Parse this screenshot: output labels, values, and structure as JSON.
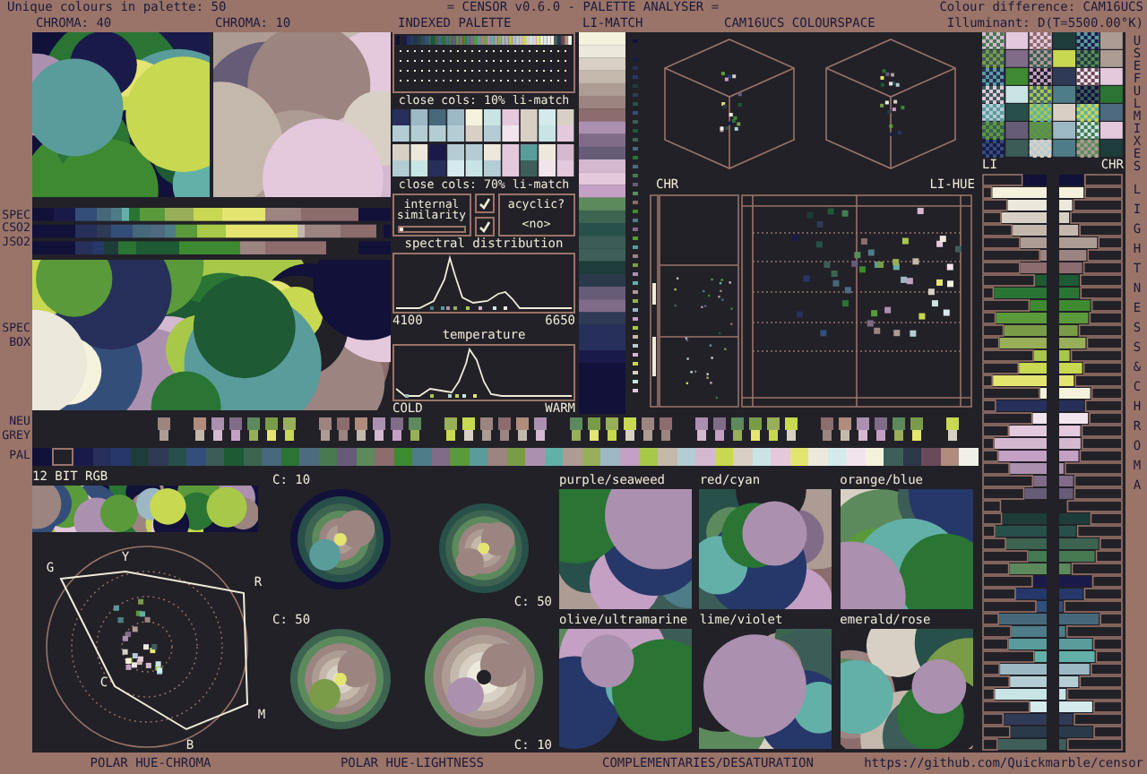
{
  "header": {
    "palette_count": "Unique colours in palette: 50",
    "title": "= CENSOR v0.6.0 - PALETTE ANALYSER =",
    "colour_difference": "Colour difference: CAM16UCS",
    "illuminant": "Illuminant: D(T=5500.00°K)"
  },
  "chroma_maps": [
    {
      "label": "CHROMA: 40"
    },
    {
      "label": "CHROMA: 10"
    }
  ],
  "spectrum_rows": [
    {
      "label": "SPEC"
    },
    {
      "label": "CSO2"
    },
    {
      "label": "JSO2"
    }
  ],
  "spec_box": {
    "label": "SPEC BOX"
  },
  "indexed_palette": {
    "title": "INDEXED PALETTE",
    "close_10": "close cols: 10% li-match",
    "close_70": "close cols: 70% li-match",
    "internal_similarity": {
      "label": "internal similarity",
      "checked": true,
      "level": 0.05
    },
    "acyclic": {
      "label": "acyclic?",
      "checked": true,
      "value": "<no>"
    },
    "spectral": {
      "title": "spectral distribution",
      "min": "4100",
      "max": "6650"
    },
    "temperature": {
      "title": "temperature",
      "min": "COLD",
      "max": "WARM"
    }
  },
  "li_match": {
    "title": "LI-MATCH"
  },
  "colourspace": {
    "title": "CAM16UCS COLOURSPACE",
    "chroma_label": "CHR",
    "hue_label": "LI-HUE"
  },
  "neutral_grey": {
    "label": "NEU GREY"
  },
  "pal": {
    "label": "PAL",
    "swatches": [
      {
        "color": "#11113a",
        "selected": false
      },
      {
        "color": "#222128",
        "selected": true
      },
      {
        "color": "#1a1a4a",
        "selected": false
      },
      {
        "color": "#26305a",
        "selected": false
      },
      {
        "color": "#26386a",
        "selected": false
      },
      {
        "color": "#1e3c3a",
        "selected": false
      },
      {
        "color": "#2f3a56",
        "selected": false
      },
      {
        "color": "#28504a",
        "selected": false
      },
      {
        "color": "#344e7a",
        "selected": false
      },
      {
        "color": "#3c5c58",
        "selected": false
      },
      {
        "color": "#1e5a34",
        "selected": false
      },
      {
        "color": "#3c6450",
        "selected": false
      },
      {
        "color": "#46687a",
        "selected": false
      },
      {
        "color": "#2a7434",
        "selected": false
      },
      {
        "color": "#4e6a80",
        "selected": false
      },
      {
        "color": "#467a50",
        "selected": false
      },
      {
        "color": "#665c78",
        "selected": false
      },
      {
        "color": "#5c8a5c",
        "selected": false
      },
      {
        "color": "#8c6c6c",
        "selected": false
      },
      {
        "color": "#3e8a30",
        "selected": false
      },
      {
        "color": "#4e7c88",
        "selected": false
      },
      {
        "color": "#806c88",
        "selected": false
      },
      {
        "color": "#5a9a3a",
        "selected": false
      },
      {
        "color": "#5a9c9c",
        "selected": false
      },
      {
        "color": "#9c8480",
        "selected": false
      },
      {
        "color": "#7a9c48",
        "selected": false
      },
      {
        "color": "#ac90b0",
        "selected": false
      },
      {
        "color": "#62b0a8",
        "selected": false
      },
      {
        "color": "#ac9c94",
        "selected": false
      },
      {
        "color": "#98ae58",
        "selected": false
      },
      {
        "color": "#9cb8c4",
        "selected": false
      },
      {
        "color": "#c4a0c4",
        "selected": false
      },
      {
        "color": "#a8c84a",
        "selected": false
      },
      {
        "color": "#c4b8ac",
        "selected": false
      },
      {
        "color": "#b4ccd4",
        "selected": false
      },
      {
        "color": "#d4b8d0",
        "selected": false
      },
      {
        "color": "#c8d850",
        "selected": false
      },
      {
        "color": "#d8d0c4",
        "selected": false
      },
      {
        "color": "#c8e4e4",
        "selected": false
      },
      {
        "color": "#e4c8dc",
        "selected": false
      },
      {
        "color": "#e4e470",
        "selected": false
      },
      {
        "color": "#ece8dc",
        "selected": false
      },
      {
        "color": "#d4eaec",
        "selected": false
      },
      {
        "color": "#f2e4ec",
        "selected": false
      },
      {
        "color": "#f4f2dc",
        "selected": false
      },
      {
        "color": "#3e5e5a",
        "selected": false
      },
      {
        "color": "#2a3a4a",
        "selected": false
      },
      {
        "color": "#6a4a5a",
        "selected": false
      },
      {
        "color": "#b08c7c",
        "selected": false
      },
      {
        "color": "#f0f0e8",
        "selected": false
      }
    ]
  },
  "rgb12": {
    "label": "12 BIT RGB"
  },
  "polar_hue_chroma": {
    "title": "POLAR HUE-CHROMA",
    "hues": [
      "G",
      "Y",
      "R",
      "C",
      "M",
      "B"
    ]
  },
  "polar_hue_lightness": {
    "title": "POLAR HUE-LIGHTNESS",
    "wheels": [
      {
        "label": "C: 10"
      },
      {
        "label": "C: 50"
      },
      {
        "label": "C: 50"
      },
      {
        "label": "C: 10"
      }
    ]
  },
  "complementaries": {
    "title": "COMPLEMENTARIES/DESATURATION",
    "pairs": [
      "purple/seaweed",
      "red/cyan",
      "orange/blue",
      "olive/ultramarine",
      "lime/violet",
      "emerald/rose"
    ]
  },
  "mixes": {
    "title": "USEFUL MIXES"
  },
  "lightness_chroma": {
    "title": "LIGHTNESS & CHROMA",
    "li_label": "LI",
    "chr_label": "CHR"
  },
  "link": "https://github.com/Quickmarble/censor"
}
